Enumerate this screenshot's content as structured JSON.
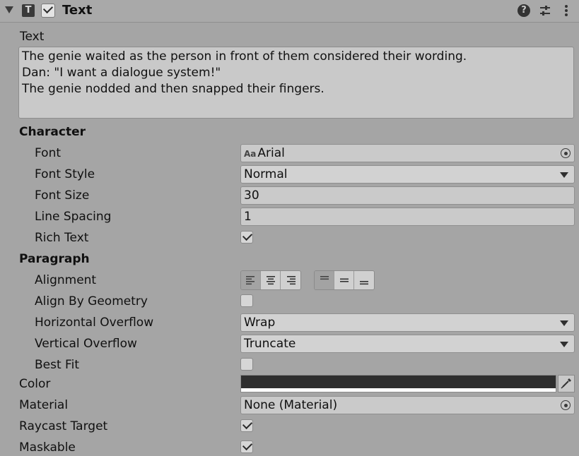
{
  "component": {
    "title": "Text",
    "type_icon_letter": "T",
    "enabled": true
  },
  "header_icons": [
    "help-icon",
    "presets-sliders-icon",
    "more-vertical-icon"
  ],
  "text_section": {
    "label": "Text",
    "value": "The genie waited as the person in front of them considered their wording.\nDan: \"I want a dialogue system!\"\nThe genie nodded and then snapped their fingers."
  },
  "character": {
    "heading": "Character",
    "font_label": "Font",
    "font_icon": "Aa",
    "font_value": "Arial",
    "font_style_label": "Font Style",
    "font_style_value": "Normal",
    "font_size_label": "Font Size",
    "font_size_value": "30",
    "line_spacing_label": "Line Spacing",
    "line_spacing_value": "1",
    "rich_text_label": "Rich Text",
    "rich_text_checked": true
  },
  "paragraph": {
    "heading": "Paragraph",
    "alignment_label": "Alignment",
    "horizontal_alignment_selected": "left",
    "vertical_alignment_selected": "top",
    "align_by_geometry_label": "Align By Geometry",
    "align_by_geometry_checked": false,
    "horizontal_overflow_label": "Horizontal Overflow",
    "horizontal_overflow_value": "Wrap",
    "vertical_overflow_label": "Vertical Overflow",
    "vertical_overflow_value": "Truncate",
    "best_fit_label": "Best Fit",
    "best_fit_checked": false
  },
  "color": {
    "label": "Color",
    "value_hex": "#2e2e2e",
    "alpha_hex": "#ffffff"
  },
  "material": {
    "label": "Material",
    "value": "None (Material)"
  },
  "raycast_target": {
    "label": "Raycast Target",
    "checked": true
  },
  "maskable": {
    "label": "Maskable",
    "checked": true
  }
}
